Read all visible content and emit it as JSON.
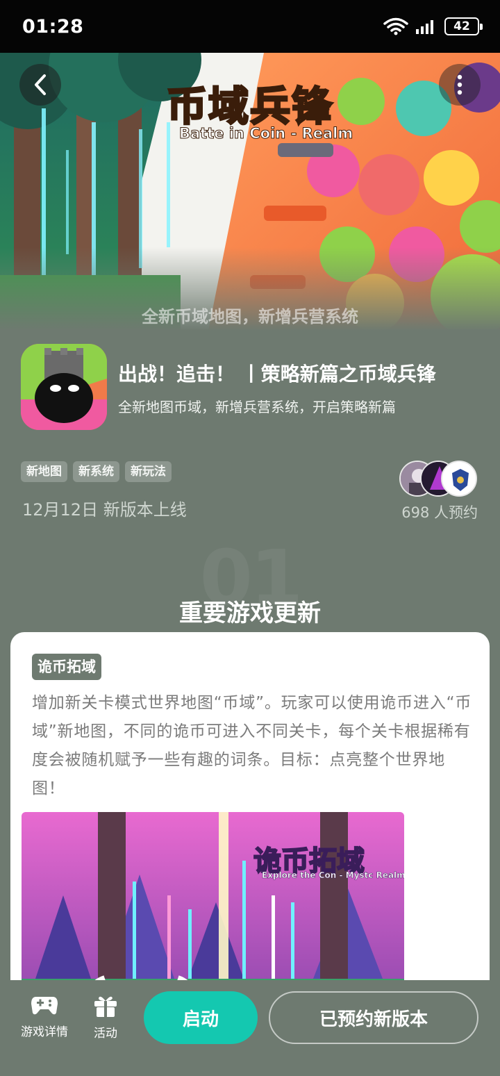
{
  "status_bar": {
    "time": "01:28",
    "battery": "42"
  },
  "banner": {
    "title": "币域兵锋",
    "subtitle": "Batte in Coin - Realm",
    "caption": "全新币域地图，新增兵营系统"
  },
  "app": {
    "title": "出战！追击！ 丨策略新篇之币域兵锋",
    "subtitle": "全新地图币域，新增兵营系统，开启策略新篇",
    "tags": [
      "新地图",
      "新系统",
      "新玩法"
    ],
    "release": "12月12日 新版本上线",
    "reserve_count": "698 人预约"
  },
  "section": {
    "number": "01",
    "title": "重要游戏更新"
  },
  "card": {
    "tag": "诡币拓域",
    "text": "增加新关卡模式世界地图“币域”。玩家可以使用诡币进入“币域”新地图，不同的诡币可进入不同关卡，每个关卡根据稀有度会被随机赋予一些有趣的词条。目标：点亮整个世界地图！",
    "image_title": "诡币拓域",
    "image_subtitle": "Explore the Con - Mystc Realm"
  },
  "bottom_bar": {
    "game_details": "游戏详情",
    "activity": "活动",
    "launch": "启动",
    "reserved": "已预约新版本"
  },
  "colors": {
    "page_bg": "#6e7a70",
    "launch_button": "#14c8b0"
  }
}
